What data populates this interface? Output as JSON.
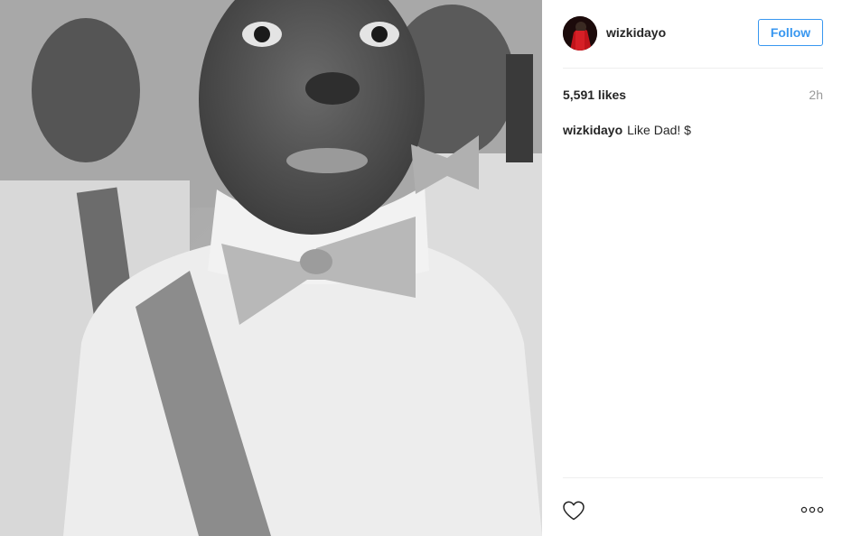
{
  "post": {
    "username": "wizkidayo",
    "follow_label": "Follow",
    "likes": "5,591 likes",
    "time": "2h",
    "caption_user": "wizkidayo",
    "caption_text": "Like Dad! $"
  },
  "icons": {
    "like": "heart-outline-icon",
    "more": "more-options-icon"
  },
  "colors": {
    "accent": "#3897f0",
    "text": "#262626",
    "muted": "#999999",
    "divider": "#efefef"
  }
}
